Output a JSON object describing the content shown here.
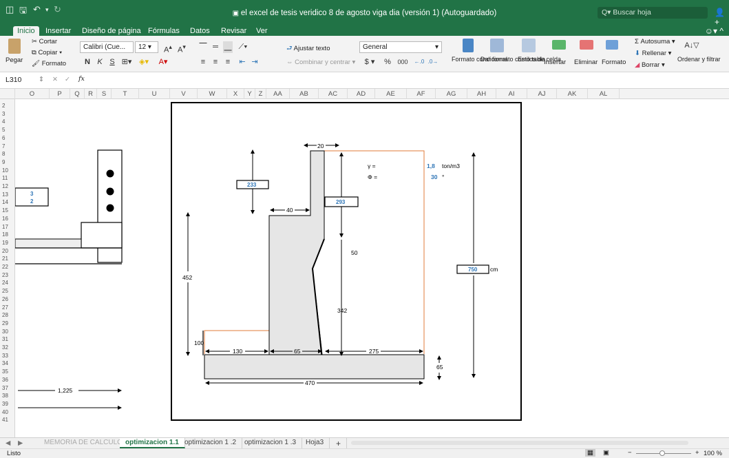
{
  "title_bar": {
    "doc_title": "el excel de tesis veridico 8 de agosto viga dia (versión 1) (Autoguardado)",
    "search_placeholder": "Buscar hoja"
  },
  "ribbon_tabs": [
    "Inicio",
    "Insertar",
    "Diseño de página",
    "Fórmulas",
    "Datos",
    "Revisar",
    "Ver"
  ],
  "ribbon": {
    "paste": "Pegar",
    "cut": "Cortar",
    "copy": "Copiar",
    "format_painter": "Formato",
    "font_name": "Calibri (Cue...",
    "font_size": "12",
    "bold": "N",
    "italic": "K",
    "underline": "S",
    "wrap_text": "Ajustar texto",
    "merge_center": "Combinar y centrar",
    "number_format": "General",
    "currency": "$",
    "percent": "%",
    "thousands": "000",
    "cond_format": "Formato condicional",
    "format_table": "Dar formato como tabla",
    "cell_styles": "Estilos de celda",
    "insert": "Insertar",
    "delete": "Eliminar",
    "format": "Formato",
    "autosum": "Autosuma",
    "fill": "Rellenar",
    "clear": "Borrar",
    "sort_filter": "Ordenar y filtrar"
  },
  "formula_bar": {
    "name_box": "L310",
    "fx": "fx",
    "formula": ""
  },
  "columns": [
    "O",
    "P",
    "Q",
    "R",
    "S",
    "T",
    "U",
    "V",
    "W",
    "X",
    "Y",
    "Z",
    "AA",
    "AB",
    "AC",
    "AD",
    "AE",
    "AF",
    "AG",
    "AH",
    "AI",
    "AJ",
    "AK",
    "AL"
  ],
  "rows": [
    "2",
    "3",
    "4",
    "5",
    "6",
    "7",
    "8",
    "9",
    "10",
    "11",
    "12",
    "13",
    "14",
    "15",
    "16",
    "17",
    "18",
    "19",
    "20",
    "21",
    "22",
    "23",
    "24",
    "25",
    "26",
    "27",
    "28",
    "29",
    "30",
    "31",
    "32",
    "33",
    "34",
    "35",
    "36",
    "37",
    "38",
    "39",
    "40",
    "41"
  ],
  "drawing": {
    "left_box_values": [
      "3",
      "2"
    ],
    "top_width": "20",
    "gamma_label": "γ =",
    "gamma_value": "1,8",
    "gamma_unit": "ton/m3",
    "phi_label": "Φ =",
    "phi_value": "30",
    "phi_unit": "°",
    "dim_233": "233",
    "dim_293": "293",
    "dim_40": "40",
    "dim_50": "50",
    "dim_452": "452",
    "dim_750": "750",
    "unit_cm": "cm",
    "dim_342": "342",
    "dim_100": "100",
    "dim_130": "130",
    "dim_65": "65",
    "dim_275": "275",
    "dim_65b": "65",
    "dim_470": "470",
    "dim_1225": "1,225"
  },
  "sheet_tabs": [
    "MEMORIA DE CALCULO",
    "optimizacion 1.1",
    "optimizacion 1 .2",
    "optimizacion 1 .3",
    "Hoja3"
  ],
  "status": {
    "ready": "Listo",
    "zoom": "100 %"
  },
  "colors": {
    "excel_green": "#217346",
    "accent_blue": "#2e75b6",
    "orange_line": "#e07b39",
    "concrete_fill": "#e6e6e6"
  }
}
